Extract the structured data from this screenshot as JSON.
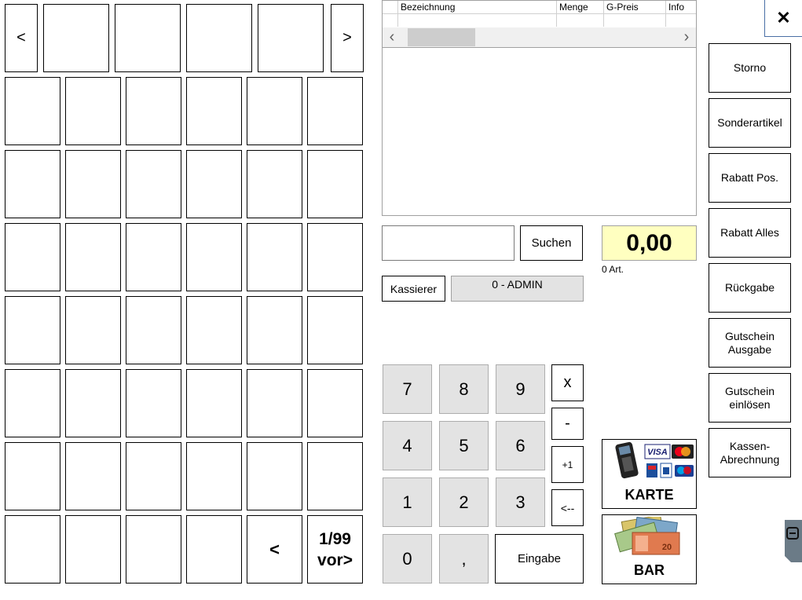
{
  "nav": {
    "prev_symbol": "<",
    "next_symbol": ">"
  },
  "paging": {
    "back_symbol": "<",
    "page_line": "1/99",
    "forward_label": "vor>"
  },
  "table": {
    "columns": [
      "Bezeichnung",
      "Menge",
      "G-Preis",
      "Info"
    ],
    "scroll_left": "‹",
    "scroll_right": "›"
  },
  "search": {
    "value": "",
    "button_label": "Suchen"
  },
  "total": {
    "amount": "0,00",
    "items": "0 Art."
  },
  "cashier": {
    "button_label": "Kassierer",
    "current": "0 - ADMIN"
  },
  "keypad": {
    "digits": [
      "7",
      "8",
      "9",
      "4",
      "5",
      "6",
      "1",
      "2",
      "3",
      "0",
      ","
    ],
    "multiply": "x",
    "minus": "-",
    "plus_one": "+1",
    "backspace": "<--",
    "enter": "Eingabe"
  },
  "payment": {
    "card_label": "KARTE",
    "cash_label": "BAR"
  },
  "close_symbol": "✕",
  "sidebar": {
    "storno": "Storno",
    "sonderartikel": "Sonderartikel",
    "rabatt_pos": "Rabatt Pos.",
    "rabatt_alles": "Rabatt Alles",
    "rueckgabe": "Rückgabe",
    "gutschein_ausgabe_1": "Gutschein",
    "gutschein_ausgabe_2": "Ausgabe",
    "gutschein_einloesen_1": "Gutschein",
    "gutschein_einloesen_2": "einlösen",
    "kassen_1": "Kassen-",
    "kassen_2": "Abrechnung"
  },
  "colors": {
    "total_bg": "#ffffc0",
    "keypad_bg": "#e3e3e3",
    "cashier_field_bg": "#e3e3e3"
  }
}
